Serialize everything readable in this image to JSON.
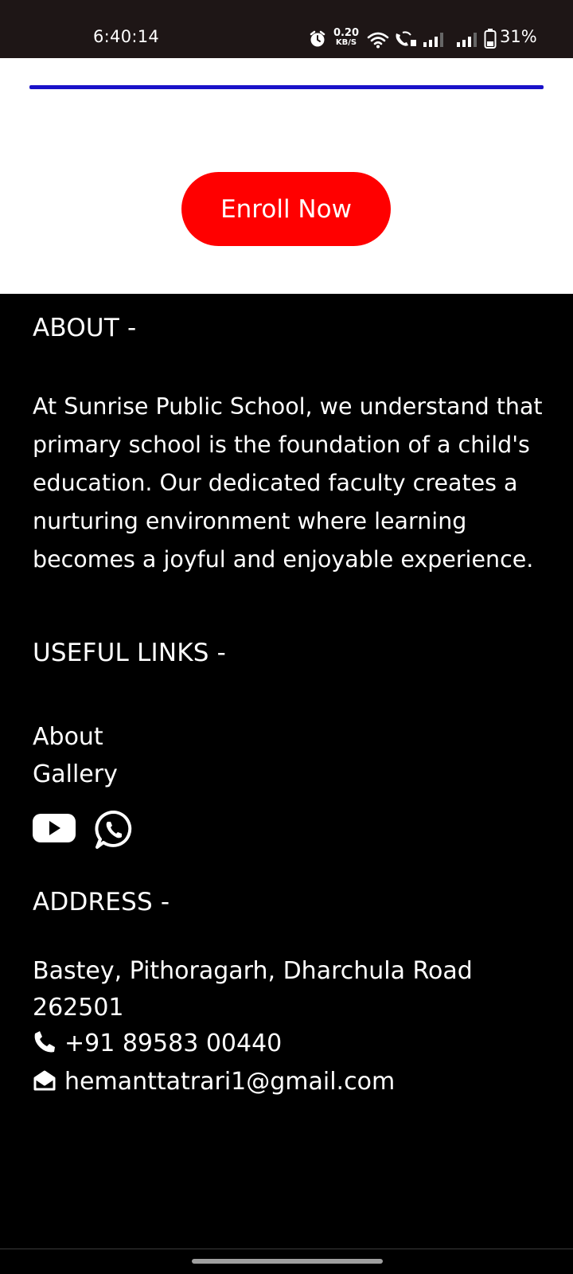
{
  "status_bar": {
    "time": "6:40:14",
    "net_speed_value": "0.20",
    "net_speed_unit": "KB/S",
    "battery_percent": "31%"
  },
  "colors": {
    "progress": "#1a12c9",
    "enroll_button": "#ff0000",
    "footer_bg": "#000000"
  },
  "hero": {
    "enroll_label": "Enroll Now"
  },
  "footer": {
    "about_heading": "ABOUT -",
    "about_text": "At Sunrise Public School, we understand that primary school is the foundation of a child's education. Our dedicated faculty creates a nurturing environment where learning becomes a joyful and enjoyable experience.",
    "links_heading": "USEFUL LINKS -",
    "links": [
      "About",
      "Gallery"
    ],
    "social_icons": [
      "youtube-icon",
      "whatsapp-icon"
    ],
    "address_heading": "ADDRESS -",
    "address_line1": "Bastey, Pithoragarh, Dharchula Road",
    "address_line2": "262501",
    "phone": "+91 89583 00440",
    "email": "hemanttatrari1@gmail.com"
  }
}
